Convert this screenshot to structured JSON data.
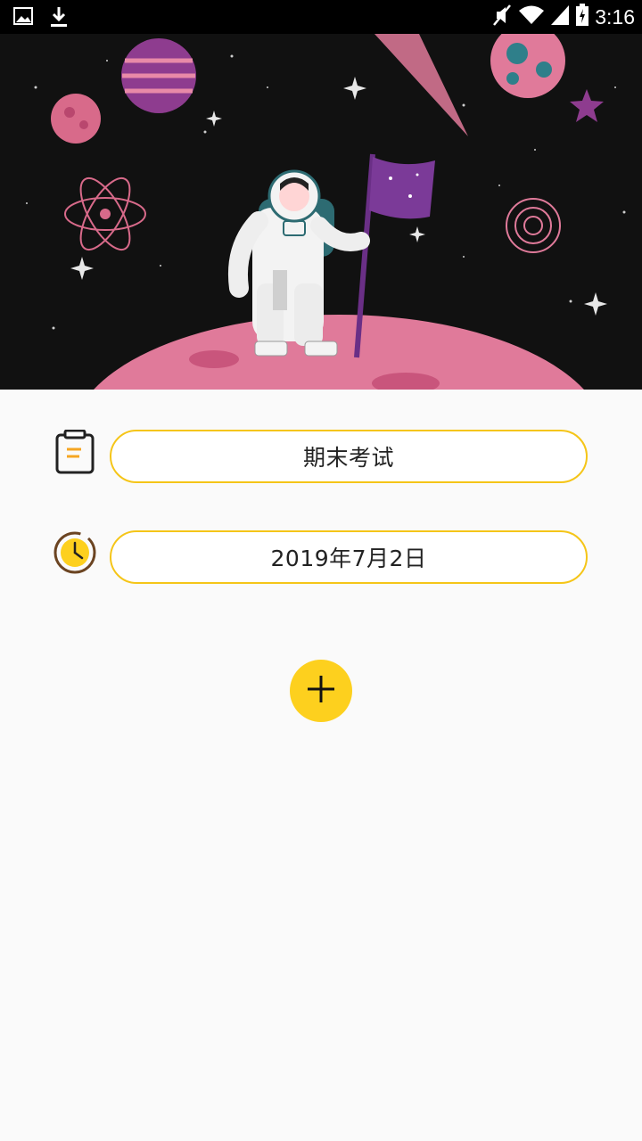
{
  "status_bar": {
    "time": "3:16",
    "left_icons": [
      "image-icon",
      "download-icon"
    ],
    "right_icons": [
      "mute-icon",
      "wifi-icon",
      "signal-icon",
      "battery-icon"
    ]
  },
  "header": {
    "illustration": "astronaut-on-pink-planet-with-flag"
  },
  "form": {
    "title_icon": "clipboard-icon",
    "title_value": "期末考试",
    "date_icon": "clock-icon",
    "date_value": "2019年7月2日"
  },
  "add_button": {
    "icon": "plus-icon"
  },
  "colors": {
    "accent": "#f5c518",
    "fab": "#fdd01e",
    "background": "#fafafa",
    "planet": "#e07a9a"
  }
}
